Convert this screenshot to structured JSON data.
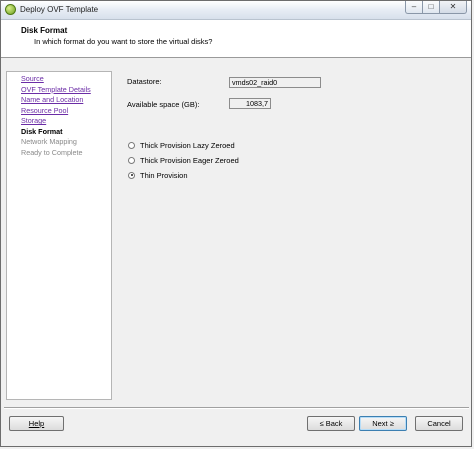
{
  "window": {
    "title": "Deploy OVF Template",
    "controls": {
      "minimize": "–",
      "maximize": "□",
      "close": "✕"
    }
  },
  "header": {
    "title": "Disk Format",
    "subtitle": "In which format do you want to store the virtual disks?"
  },
  "nav": {
    "items": [
      {
        "label": "Source",
        "state": "link"
      },
      {
        "label": "OVF Template Details",
        "state": "link"
      },
      {
        "label": "Name and Location",
        "state": "link"
      },
      {
        "label": "Resource Pool",
        "state": "link"
      },
      {
        "label": "Storage",
        "state": "link"
      },
      {
        "label": "Disk Format",
        "state": "active"
      },
      {
        "label": "Network Mapping",
        "state": "pending"
      },
      {
        "label": "Ready to Complete",
        "state": "pending"
      }
    ]
  },
  "form": {
    "datastore_label": "Datastore:",
    "datastore_value": "vmds02_raid0",
    "space_label": "Available space (GB):",
    "space_value": "1083,7",
    "options": [
      {
        "label": "Thick Provision Lazy Zeroed",
        "selected": false
      },
      {
        "label": "Thick Provision Eager Zeroed",
        "selected": false
      },
      {
        "label": "Thin Provision",
        "selected": true
      }
    ]
  },
  "footer": {
    "help": "Help",
    "back": "≤ Back",
    "next": "Next ≥",
    "cancel": "Cancel"
  }
}
